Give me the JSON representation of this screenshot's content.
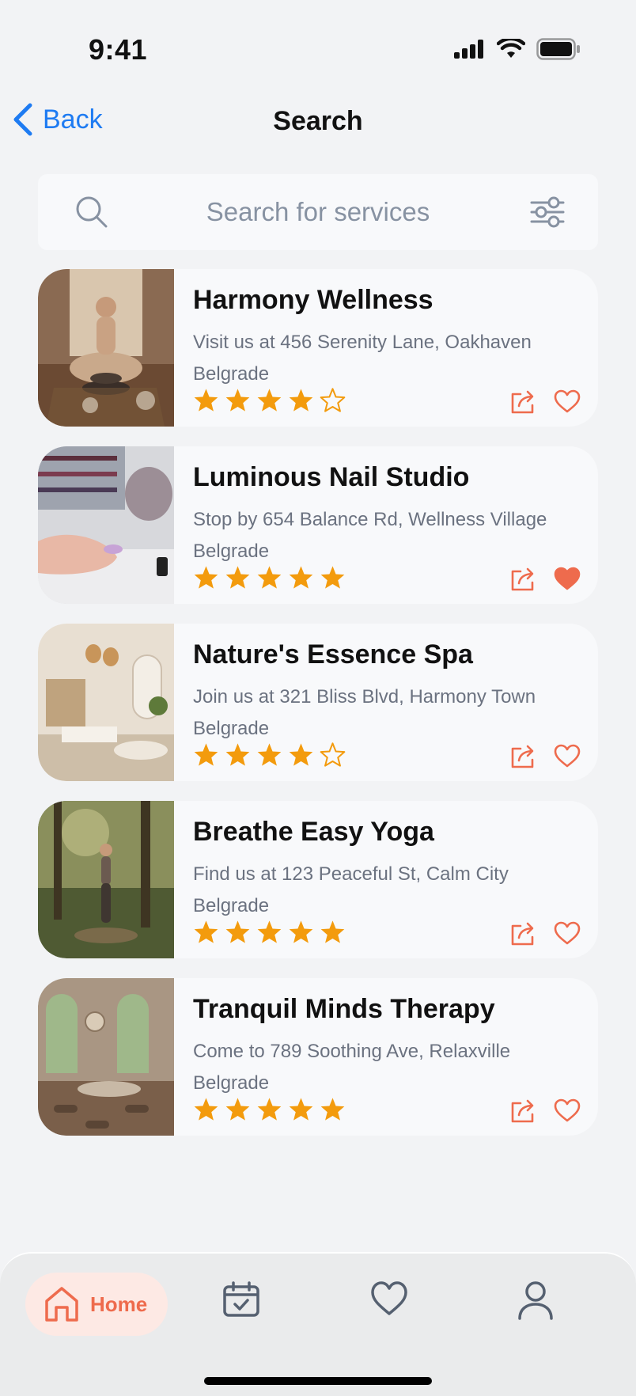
{
  "status": {
    "time": "9:41"
  },
  "nav": {
    "back_label": "Back",
    "title": "Search"
  },
  "search": {
    "placeholder": "Search for services",
    "value": ""
  },
  "colors": {
    "accent": "#EE6B4D",
    "star": "#F39B0D",
    "link": "#1E7BF2"
  },
  "results": [
    {
      "name": "Harmony Wellness",
      "address": "Visit us at 456 Serenity Lane, Oakhaven",
      "city": "Belgrade",
      "rating": 4,
      "favorite": false
    },
    {
      "name": "Luminous Nail Studio",
      "address": "Stop by 654 Balance Rd, Wellness Village",
      "city": "Belgrade",
      "rating": 5,
      "favorite": true
    },
    {
      "name": "Nature's Essence Spa",
      "address": "Join us at 321 Bliss Blvd, Harmony Town",
      "city": "Belgrade",
      "rating": 4,
      "favorite": false
    },
    {
      "name": "Breathe Easy Yoga",
      "address": "Find us at 123 Peaceful St, Calm City",
      "city": "Belgrade",
      "rating": 5,
      "favorite": false
    },
    {
      "name": "Tranquil Minds Therapy",
      "address": "Come to 789 Soothing Ave, Relaxville",
      "city": "Belgrade",
      "rating": 5,
      "favorite": false
    }
  ],
  "tabbar": {
    "items": [
      {
        "label": "Home",
        "icon": "home-icon",
        "active": true
      },
      {
        "label": "",
        "icon": "calendar-icon",
        "active": false
      },
      {
        "label": "",
        "icon": "heart-icon",
        "active": false
      },
      {
        "label": "",
        "icon": "profile-icon",
        "active": false
      }
    ]
  }
}
